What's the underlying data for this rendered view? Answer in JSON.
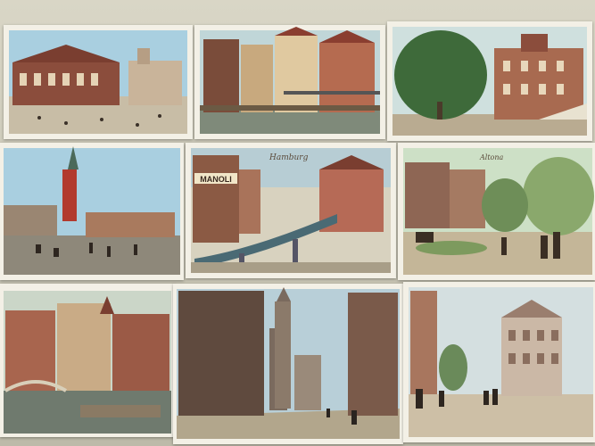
{
  "scene": "Collection of nine vintage Hamburg postcards laid out in a 3x3 grid on a table",
  "postcards": [
    {
      "id": "card-1",
      "subject": "Stadttheater street scene"
    },
    {
      "id": "card-2",
      "subject": "Half-timbered houses by the canal"
    },
    {
      "id": "card-3",
      "subject": "Tree-lined avenue with buildings"
    },
    {
      "id": "card-4",
      "subject": "Harbor square with church spire"
    },
    {
      "id": "card-5",
      "subject": "Elevated railway viaduct",
      "caption": "Hamburg",
      "sign": "MANOLI"
    },
    {
      "id": "card-6",
      "subject": "Altona park promenade",
      "caption": "Altona"
    },
    {
      "id": "card-7",
      "subject": "Canal with houses and bridge"
    },
    {
      "id": "card-8",
      "subject": "Street with town hall tower"
    },
    {
      "id": "card-9",
      "subject": "Busy street with tall building"
    }
  ],
  "colors": {
    "sky": "#9fc6da",
    "brick": "#8a4a3a",
    "paper": "#f3f0e6",
    "street": "#b9ab91"
  }
}
